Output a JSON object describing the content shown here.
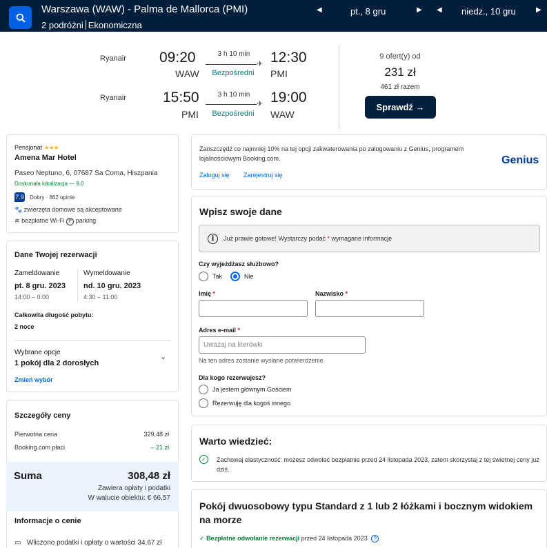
{
  "header": {
    "route": "Warszawa (WAW) - Palma de Mallorca (PMI)",
    "travelers": "2 podróżni",
    "cabin": "Ekonomiczna",
    "depart_date": "pt., 8 gru",
    "return_date": "niedz., 10 gru"
  },
  "flights": {
    "outbound": {
      "airline": "Ryanair",
      "dep_time": "09:20",
      "dep_code": "WAW",
      "duration": "3 h 10 min",
      "stops": "Bezpośredni",
      "arr_time": "12:30",
      "arr_code": "PMI"
    },
    "inbound": {
      "airline": "Ryanair",
      "dep_time": "15:50",
      "dep_code": "PMI",
      "duration": "3 h 10 min",
      "stops": "Bezpośredni",
      "arr_time": "19:00",
      "arr_code": "WAW"
    },
    "offers": "9 ofert(y) od",
    "price": "231 zł",
    "total": "461 zł razem",
    "check_label": "Sprawdź →"
  },
  "hotel": {
    "type": "Pensjonat",
    "stars": "★★★",
    "name": "Amena Mar Hotel",
    "address": "Paseo Neptuno, 6, 07687 Sa Coma, Hiszpania",
    "location": "Doskonała lokalizacja — 9.0",
    "score": "7.9",
    "score_text": "Dobry · 862 opinie",
    "pets": "zwierzęta domowe są akceptowane",
    "wifi": "bezpłatne Wi-Fi",
    "parking": "parking"
  },
  "reservation": {
    "title": "Dane Twojej rezerwacji",
    "checkin_label": "Zameldowanie",
    "checkin_date": "pt. 8 gru. 2023",
    "checkin_time": "14:00 – 0:00",
    "checkout_label": "Wymeldowanie",
    "checkout_date": "nd. 10 gru. 2023",
    "checkout_time": "4:30 – 11:00",
    "stay_label": "Całkowita długość pobytu:",
    "stay_value": "2 noce",
    "options_label": "Wybrane opcje",
    "options_value": "1 pokój dla 2 dorosłych",
    "change_link": "Zmień wybór"
  },
  "price_details": {
    "title": "Szczegóły ceny",
    "original_label": "Pierwotna cena",
    "original_value": "329,48 zł",
    "booking_label": "Booking.com płaci",
    "booking_value": "– 21 zł",
    "sum_label": "Suma",
    "sum_value": "308,48 zł",
    "sum_note1": "Zawiera opłaty i podatki",
    "sum_note2": "W walucie obiektu: € 66,57",
    "info_title": "Informacje o cenie",
    "info_text": "Wliczono podatki i opłaty o wartości 34,67 zł"
  },
  "genius": {
    "text": "Zaoszczędź co najmniej 10% na tej opcji zakwaterowania po zalogowaniu z Genius, programem lojalnościowym Booking.com.",
    "login": "Zaloguj się",
    "register": "Zarejestruj się",
    "logo": "Genius"
  },
  "form": {
    "title": "Wpisz swoje dane",
    "info_text": "Już prawie gotowe! Wystarczy podać",
    "info_star": "*",
    "info_tail": "wymagane informacje",
    "business_q": "Czy wyjeżdżasz służbowo?",
    "yes": "Tak",
    "no": "Nie",
    "first_name": "Imię",
    "last_name": "Nazwisko",
    "email": "Adres e-mail",
    "email_placeholder": "Uważaj na literówki",
    "email_note": "Na ten adres zostanie wysłane potwierdzenie",
    "for_whom": "Dla kogo rezerwujesz?",
    "main_guest": "Ja jestem głównym Gościem",
    "someone_else": "Rezerwuję dla kogoś innego",
    "req_star": "*"
  },
  "worth": {
    "title": "Warto wiedzieć:",
    "text": "Zachowaj elastyczność: możesz odwołać bezpłatnie przed 24 listopada 2023, zatem skorzystaj z tej świetnej ceny już dziś."
  },
  "room": {
    "title": "Pokój dwuosobowy typu Standard z 1 lub 2 łóżkami i bocznym widokiem na morze",
    "cancel_bold": "Bezpłatne odwołanie rezerwacji",
    "cancel_rest": "przed 24 listopada 2023"
  }
}
